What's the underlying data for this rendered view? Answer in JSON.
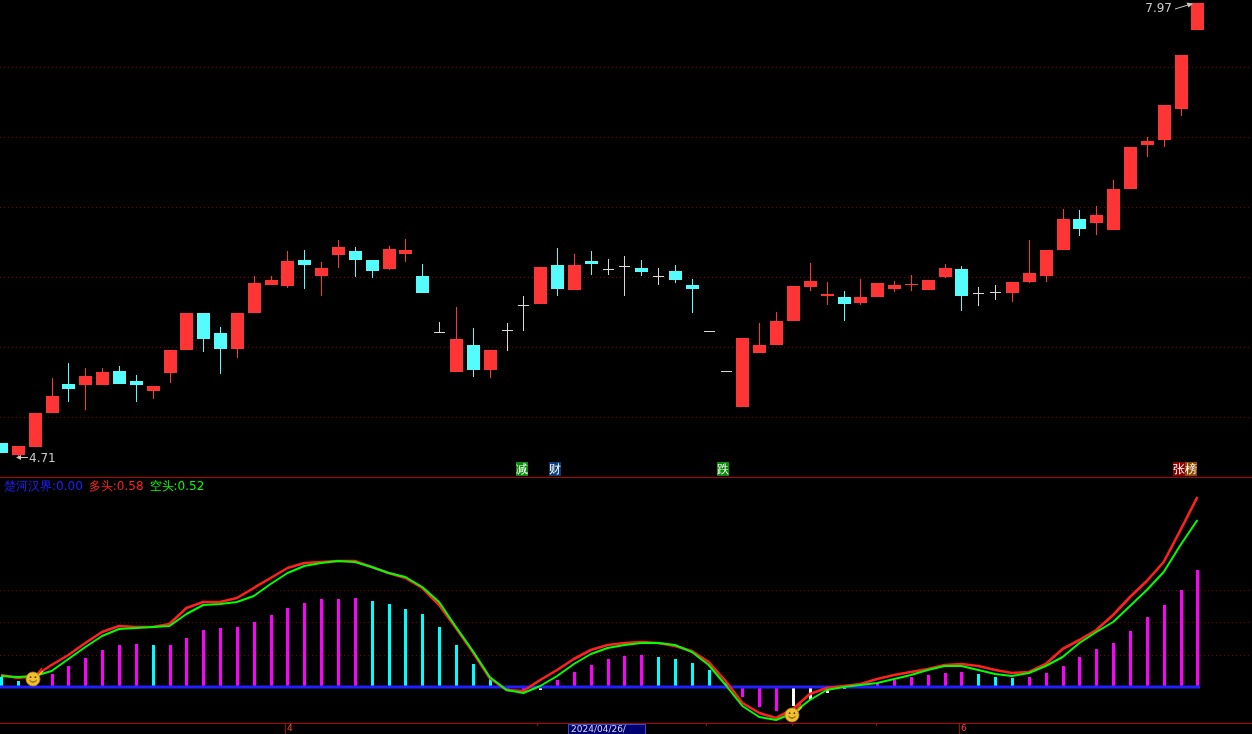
{
  "price_chart": {
    "high_label": "7.97",
    "low_label": "4.71"
  },
  "signal_markers": [
    {
      "text": "减",
      "color": "#0a8a0a"
    },
    {
      "text": "财",
      "color": "#0c3c78"
    },
    {
      "text": "跌",
      "color": "#0a8a0a"
    },
    {
      "text": "张",
      "color": "#8c0000"
    },
    {
      "text": "榜",
      "color": "#8c4a00"
    }
  ],
  "indicator": {
    "legend": [
      {
        "text": "楚河汉界:0.00",
        "color": "#2020ff"
      },
      {
        "text": "多头:0.58",
        "color": "#ff2020"
      },
      {
        "text": "空头:0.52",
        "color": "#00ff00"
      }
    ]
  },
  "time_axis": {
    "labels": [
      {
        "text": "4",
        "kind": "month"
      },
      {
        "text": "2024/04/26/",
        "kind": "cursor"
      },
      {
        "text": "6",
        "kind": "month"
      }
    ]
  }
}
